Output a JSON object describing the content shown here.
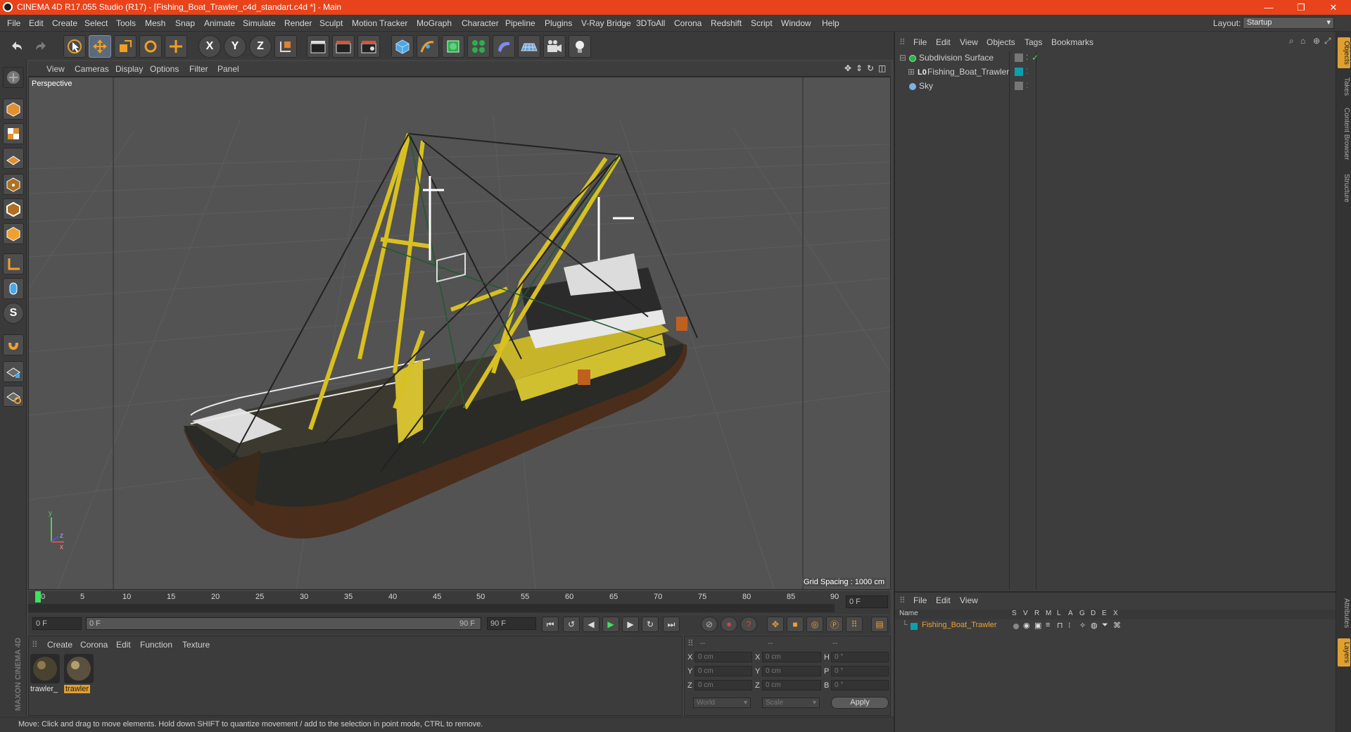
{
  "window": {
    "title": "CINEMA 4D R17.055 Studio (R17) - [Fishing_Boat_Trawler_c4d_standart.c4d *] - Main",
    "minimize": "—",
    "maximize": "❐",
    "close": "✕"
  },
  "menu": [
    "File",
    "Edit",
    "Create",
    "Select",
    "Tools",
    "Mesh",
    "Snap",
    "Animate",
    "Simulate",
    "Render",
    "Sculpt",
    "Motion Tracker",
    "MoGraph",
    "Character",
    "Pipeline",
    "Plugins",
    "V-Ray Bridge",
    "3DToAll",
    "Corona",
    "Redshift",
    "Script",
    "Window",
    "Help"
  ],
  "layout": {
    "label": "Layout:",
    "value": "Startup"
  },
  "viewport": {
    "menu": [
      "View",
      "Cameras",
      "Display",
      "Options",
      "Filter",
      "Panel"
    ],
    "label": "Perspective",
    "grid_spacing": "Grid Spacing : 1000 cm"
  },
  "timeline": {
    "ticks": [
      "0",
      "5",
      "10",
      "15",
      "20",
      "25",
      "30",
      "35",
      "40",
      "45",
      "50",
      "55",
      "60",
      "65",
      "70",
      "75",
      "80",
      "85",
      "90"
    ],
    "current_frame": "0 F",
    "start": "0 F",
    "range_start": "0 F",
    "range_end": "90 F",
    "end": "90 F"
  },
  "material_manager": {
    "menu": [
      "Create",
      "Corona",
      "Edit",
      "Function",
      "Texture"
    ],
    "materials": [
      {
        "name": "trawler_",
        "selected": false
      },
      {
        "name": "trawler",
        "selected": true
      }
    ]
  },
  "coordinates": {
    "header": [
      "--",
      "--",
      "--"
    ],
    "rows": [
      {
        "a": "X",
        "av": "0 cm",
        "b": "X",
        "bv": "0 cm",
        "c": "H",
        "cv": "0 °"
      },
      {
        "a": "Y",
        "av": "0 cm",
        "b": "Y",
        "bv": "0 cm",
        "c": "P",
        "cv": "0 °"
      },
      {
        "a": "Z",
        "av": "0 cm",
        "b": "Z",
        "bv": "0 cm",
        "c": "B",
        "cv": "0 °"
      }
    ],
    "mode": "World",
    "scale": "Scale",
    "apply": "Apply"
  },
  "status": "Move: Click and drag to move elements. Hold down SHIFT to quantize movement / add to the selection in point mode, CTRL to remove.",
  "object_manager": {
    "menu": [
      "File",
      "Edit",
      "View",
      "Objects",
      "Tags",
      "Bookmarks"
    ],
    "objects": [
      {
        "name": "Subdivision Surface",
        "icon": "subdivision-icon"
      },
      {
        "name": "Fishing_Boat_Trawler",
        "icon": "null-object-icon"
      },
      {
        "name": "Sky",
        "icon": "sky-icon"
      }
    ]
  },
  "layer_manager": {
    "menu": [
      "File",
      "Edit",
      "View"
    ],
    "columns": [
      "Name",
      "S",
      "V",
      "R",
      "M",
      "L",
      "A",
      "G",
      "D",
      "E",
      "X"
    ],
    "layers": [
      {
        "name": "Fishing_Boat_Trawler",
        "color": "#0aa0b0"
      }
    ]
  },
  "side_tabs": [
    "Objects",
    "Takes",
    "Content Browser",
    "Structure",
    "Attributes",
    "Layers"
  ],
  "brand": "MAXON CINEMA 4D",
  "colors": {
    "titlebar": "#e8431b",
    "accent": "#e0a030",
    "layer": "#0aa0b0"
  }
}
